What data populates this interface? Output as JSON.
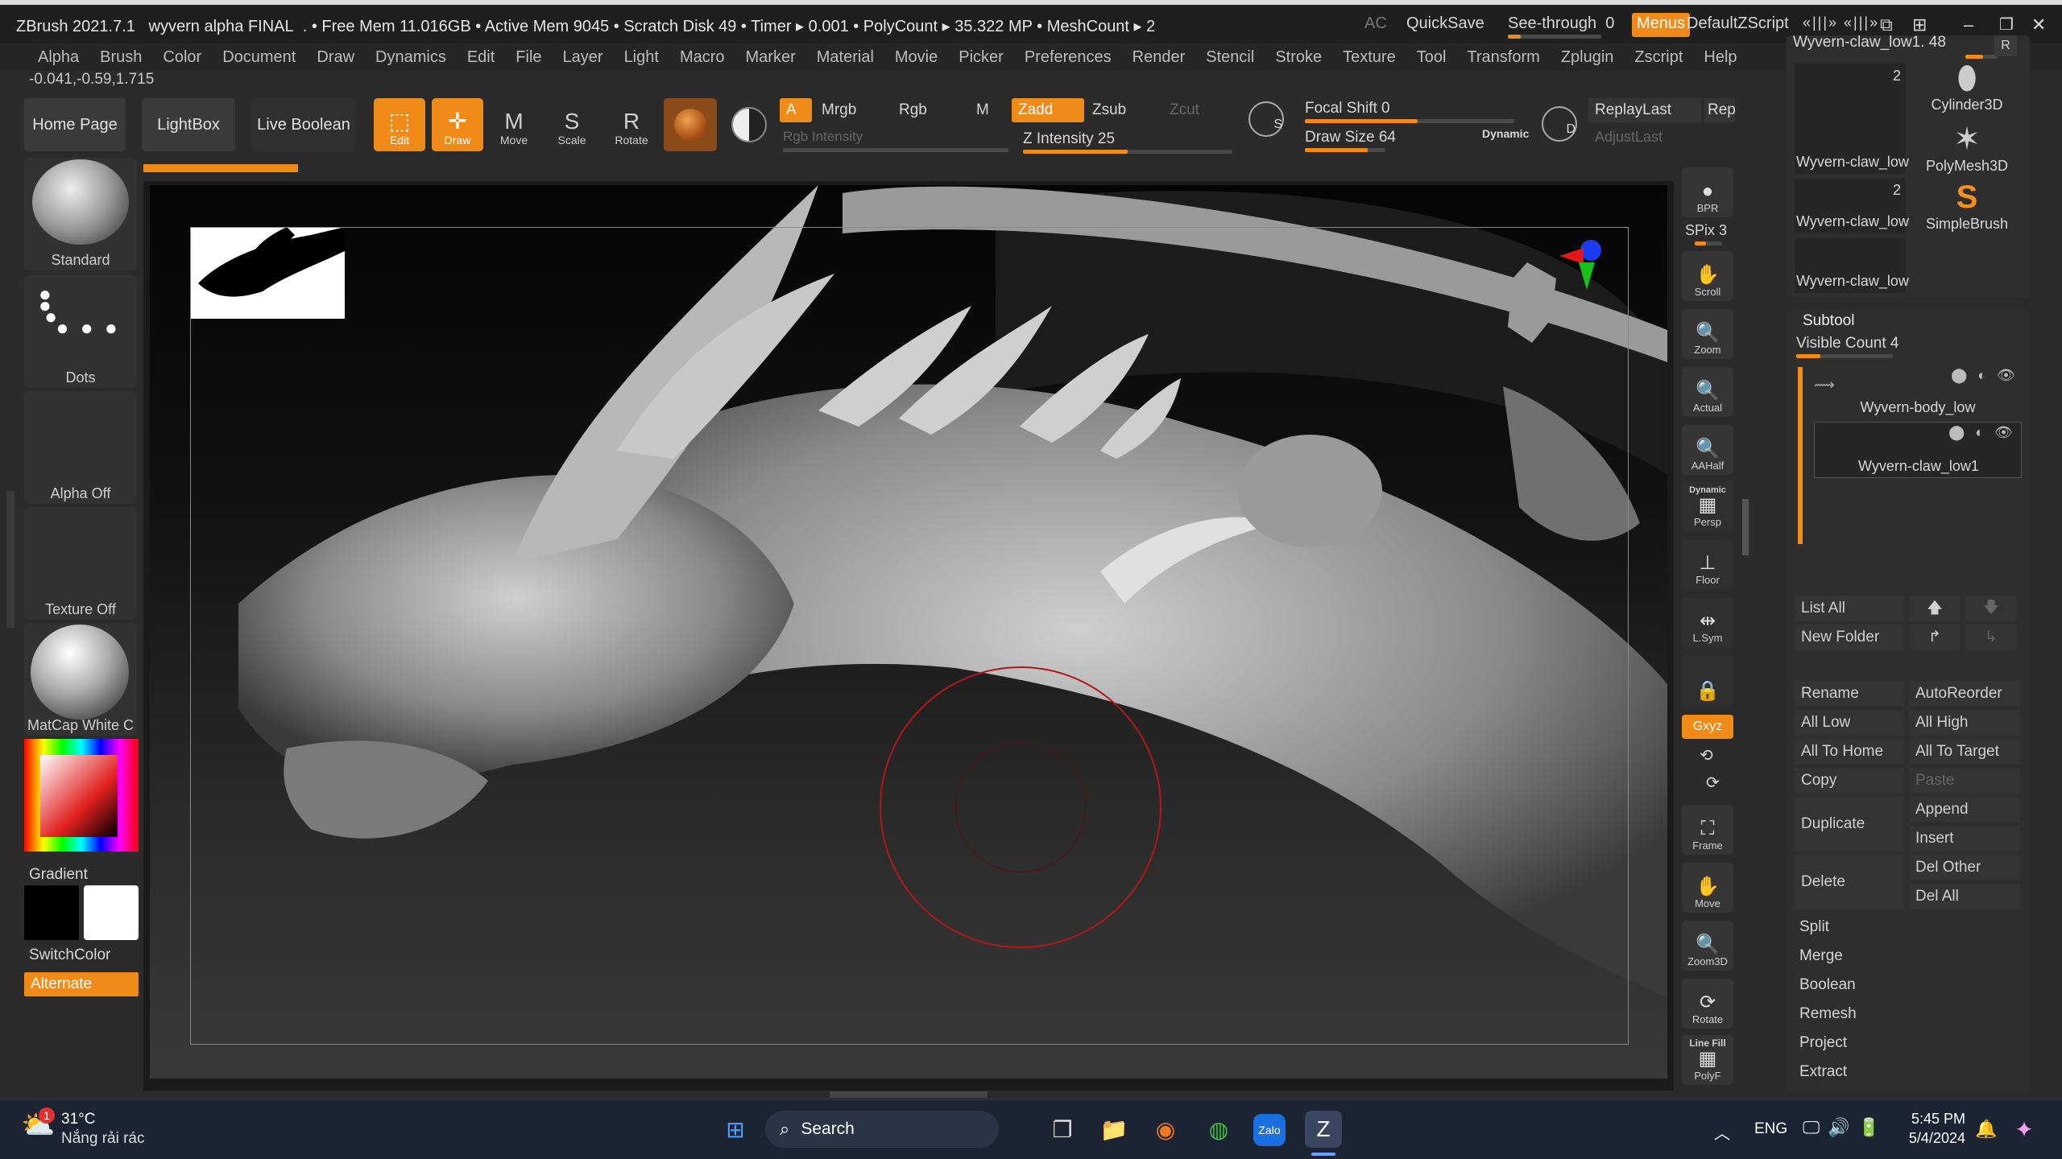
{
  "title": {
    "app": "ZBrush 2021.7.1",
    "doc": "wyvern alpha FINAL",
    "stats": ". • Free Mem 11.016GB • Active Mem 9045 • Scratch Disk 49 • Timer ▸ 0.001 • PolyCount ▸ 35.322 MP • MeshCount ▸ 2"
  },
  "topright": {
    "ac": "AC",
    "quicksave": "QuickSave",
    "seethrough": "See-through",
    "seethrough_val": "0",
    "menus": "Menus",
    "script": "DefaultZScript"
  },
  "menus": [
    "Alpha",
    "Brush",
    "Color",
    "Document",
    "Draw",
    "Dynamics",
    "Edit",
    "File",
    "Layer",
    "Light",
    "Macro",
    "Marker",
    "Material",
    "Movie",
    "Picker",
    "Preferences",
    "Render",
    "Stencil",
    "Stroke",
    "Texture",
    "Tool",
    "Transform",
    "Zplugin",
    "Zscript",
    "Help"
  ],
  "coords": "-0.041,-0.59,1.715",
  "shelf": {
    "home": "Home Page",
    "lightbox": "LightBox",
    "liveboolean": "Live Boolean",
    "edit": "Edit",
    "draw": "Draw",
    "move": "Move",
    "scale": "Scale",
    "rotate": "Rotate",
    "a": "A",
    "mrgb": "Mrgb",
    "rgb": "Rgb",
    "m": "M",
    "rgb_int": "Rgb Intensity",
    "zadd": "Zadd",
    "zsub": "Zsub",
    "zcut": "Zcut",
    "z_int": "Z Intensity 25",
    "focal": "Focal Shift 0",
    "drawsize": "Draw Size 64",
    "dynamic": "Dynamic",
    "replay": "ReplayLast",
    "rep": "Rep",
    "adjust": "AdjustLast",
    "s": "S",
    "d": "D"
  },
  "left": {
    "brush": "Standard",
    "stroke": "Dots",
    "alpha": "Alpha Off",
    "texture": "Texture Off",
    "material": "MatCap White C",
    "gradient": "Gradient",
    "switch": "SwitchColor",
    "alternate": "Alternate"
  },
  "rightstrip": {
    "bpr": "BPR",
    "spix": "SPix 3",
    "scroll": "Scroll",
    "zoom": "Zoom",
    "actual": "Actual",
    "aahalf": "AAHalf",
    "dynamic": "Dynamic",
    "persp": "Persp",
    "floor": "Floor",
    "lsym": "L.Sym",
    "xyz": "Gxyz",
    "frame": "Frame",
    "move": "Move",
    "zoom3d": "Zoom3D",
    "rotate": "Rotate",
    "linefill": "Line Fill",
    "polyf": "PolyF"
  },
  "tool": {
    "current": "Wyvern-claw_low1. 48",
    "r": "R",
    "thumbs": [
      {
        "name": "Wyvern-claw_low",
        "count": "2"
      },
      {
        "name": "Wyvern-claw_low",
        "count": "2"
      },
      {
        "name": "Wyvern-claw_low",
        "count": ""
      }
    ],
    "cylinder": "Cylinder3D",
    "polymesh": "PolyMesh3D",
    "simplebrush": "SimpleBrush"
  },
  "subtool": {
    "header": "Subtool",
    "visible": "Visible Count 4",
    "items": [
      "Wyvern-body_low",
      "Wyvern-claw_low1"
    ]
  },
  "subtool_btns": {
    "listall": "List All",
    "newfolder": "New Folder",
    "rename": "Rename",
    "autoreorder": "AutoReorder",
    "alllow": "All Low",
    "allhigh": "All High",
    "alltohome": "All To Home",
    "alltotarget": "All To Target",
    "copy": "Copy",
    "paste": "Paste",
    "duplicate": "Duplicate",
    "append": "Append",
    "insert": "Insert",
    "delete": "Delete",
    "delother": "Del Other",
    "delall": "Del All"
  },
  "subtool_sections": [
    "Split",
    "Merge",
    "Boolean",
    "Remesh",
    "Project",
    "Extract"
  ],
  "taskbar": {
    "temp": "31°C",
    "weather": "Nắng rải rác",
    "search": "Search",
    "lang": "ENG",
    "time": "5:45 PM",
    "date": "5/4/2024",
    "badge": "1"
  }
}
